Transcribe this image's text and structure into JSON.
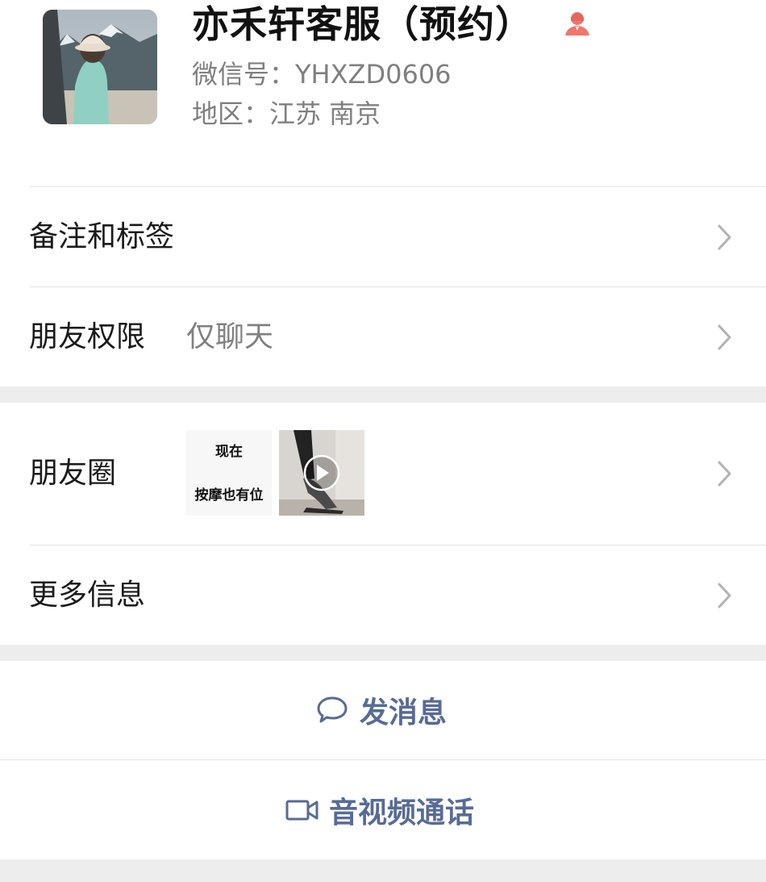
{
  "profile": {
    "name": "亦禾轩客服（预约）",
    "wechat_id": "微信号：YHXZD0606",
    "region": "地区：江苏 南京",
    "badge_icon": "female-user-icon",
    "badge_color": "#f0776c"
  },
  "menu": {
    "remarks_tags": "备注和标签",
    "friend_permissions": "朋友权限",
    "friend_permissions_value": "仅聊天",
    "moments": "朋友圈",
    "more_info": "更多信息"
  },
  "moments_preview": {
    "text_line1": "现在",
    "text_line2": "按摩也有位",
    "photo_icon": "video-play-icon"
  },
  "actions": {
    "send_message": "发消息",
    "send_message_icon": "chat-bubble-icon",
    "av_call": "音视频通话",
    "av_call_icon": "video-camera-icon",
    "accent_color": "#576b95"
  }
}
